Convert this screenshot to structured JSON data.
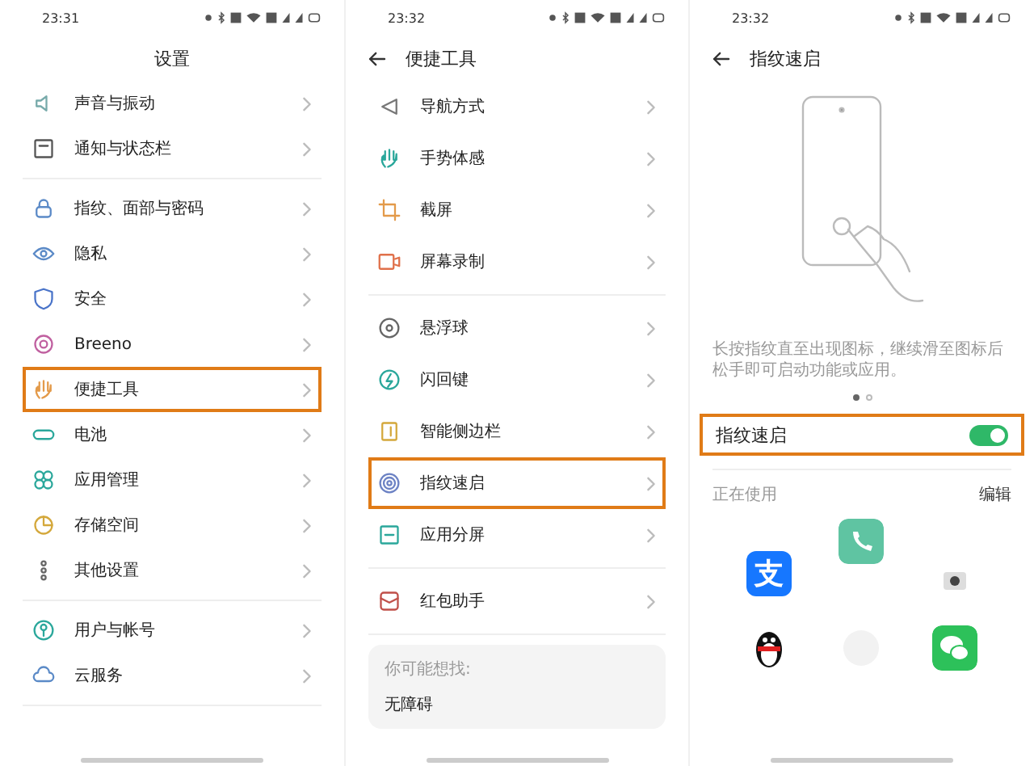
{
  "screens": [
    {
      "kind": "list",
      "status_bar": {
        "time": "23:31"
      },
      "header": {
        "title": "设置",
        "back": false
      },
      "groups": [
        [
          {
            "label": "声音与振动",
            "highlighted": false
          },
          {
            "label": "通知与状态栏",
            "highlighted": false
          }
        ],
        [
          {
            "label": "指纹、面部与密码",
            "highlighted": false
          },
          {
            "label": "隐私",
            "highlighted": false
          },
          {
            "label": "安全",
            "highlighted": false
          },
          {
            "label": "Breeno",
            "highlighted": false
          },
          {
            "label": "便捷工具",
            "highlighted": true
          },
          {
            "label": "电池",
            "highlighted": false
          },
          {
            "label": "应用管理",
            "highlighted": false
          },
          {
            "label": "存储空间",
            "highlighted": false
          },
          {
            "label": "其他设置",
            "highlighted": false
          }
        ],
        [
          {
            "label": "用户与帐号",
            "highlighted": false
          },
          {
            "label": "云服务",
            "highlighted": false
          }
        ]
      ]
    },
    {
      "kind": "list",
      "status_bar": {
        "time": "23:32"
      },
      "header": {
        "title": "便捷工具",
        "back": true
      },
      "groups": [
        [
          {
            "label": "导航方式",
            "highlighted": false
          },
          {
            "label": "手势体感",
            "highlighted": false
          },
          {
            "label": "截屏",
            "highlighted": false
          },
          {
            "label": "屏幕录制",
            "highlighted": false
          }
        ],
        [
          {
            "label": "悬浮球",
            "highlighted": false
          },
          {
            "label": "闪回键",
            "highlighted": false
          },
          {
            "label": "智能侧边栏",
            "highlighted": false
          },
          {
            "label": "指纹速启",
            "highlighted": true
          },
          {
            "label": "应用分屏",
            "highlighted": false
          }
        ],
        [
          {
            "label": "红包助手",
            "highlighted": false
          }
        ]
      ],
      "suggest": {
        "label": "你可能想找:",
        "items": [
          "无障碍"
        ]
      }
    },
    {
      "kind": "detail",
      "status_bar": {
        "time": "23:32"
      },
      "header": {
        "title": "指纹速启",
        "back": true
      },
      "description": "长按指纹直至出现图标，继续滑至图标后松手即可启动功能或应用。",
      "pager": [
        {
          "selected": true
        },
        {
          "selected": false
        }
      ],
      "toggle": {
        "label": "指纹速启",
        "on": true,
        "highlighted": true
      },
      "section": {
        "label": "正在使用",
        "action": "编辑"
      },
      "apps": [
        {
          "kind": "glyph",
          "glyph": "支"
        },
        {
          "kind": "phone"
        },
        {
          "kind": "camera"
        },
        {
          "kind": "penguin"
        },
        {
          "kind": "faded"
        },
        {
          "kind": "chat"
        }
      ]
    }
  ]
}
